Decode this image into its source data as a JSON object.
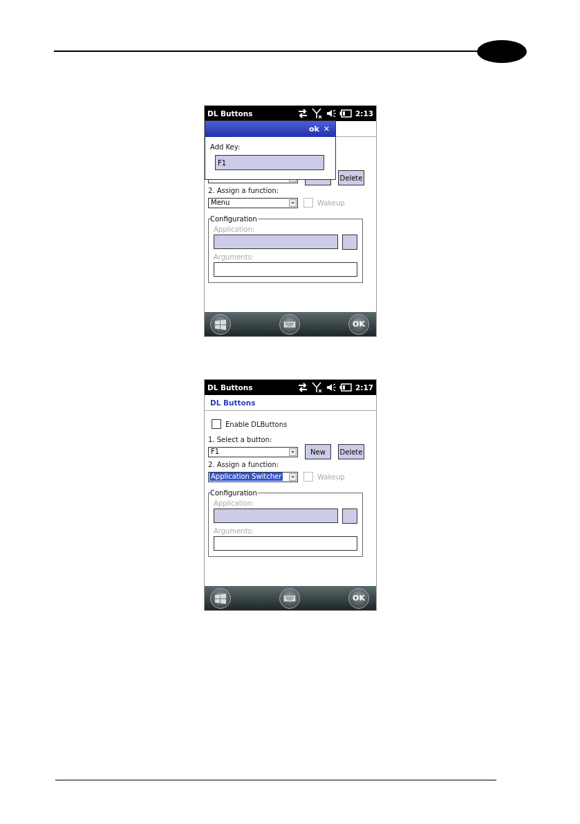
{
  "screens": [
    {
      "status": {
        "title": "DL Buttons",
        "time": "2:13"
      },
      "dialog": {
        "action": "ok",
        "close": "✕",
        "label": "Add Key:",
        "value": "F1"
      },
      "select": {
        "delete_button": "Delete"
      },
      "assign": {
        "label": "2. Assign a function:",
        "value": "Menu",
        "selected": false,
        "wakeup": {
          "label": "Wakeup",
          "checked": false,
          "disabled": true
        }
      },
      "configuration": {
        "title": "Configuration",
        "application_label": "Application:",
        "browse": "...",
        "arguments_label": "Arguments:"
      },
      "softkeys": {
        "ok": "OK"
      }
    },
    {
      "status": {
        "title": "DL Buttons",
        "time": "2:17"
      },
      "header_title": "DL Buttons",
      "enable": {
        "label": "Enable DLButtons",
        "checked": false
      },
      "select": {
        "label": "1. Select a button:",
        "value": "F1",
        "new_button": "New",
        "delete_button": "Delete"
      },
      "assign": {
        "label": "2. Assign a function:",
        "value": "Application Switcher",
        "selected": true,
        "wakeup": {
          "label": "Wakeup",
          "checked": false,
          "disabled": true
        }
      },
      "configuration": {
        "title": "Configuration",
        "application_label": "Application:",
        "browse": "...",
        "arguments_label": "Arguments:"
      },
      "softkeys": {
        "ok": "OK"
      }
    }
  ]
}
